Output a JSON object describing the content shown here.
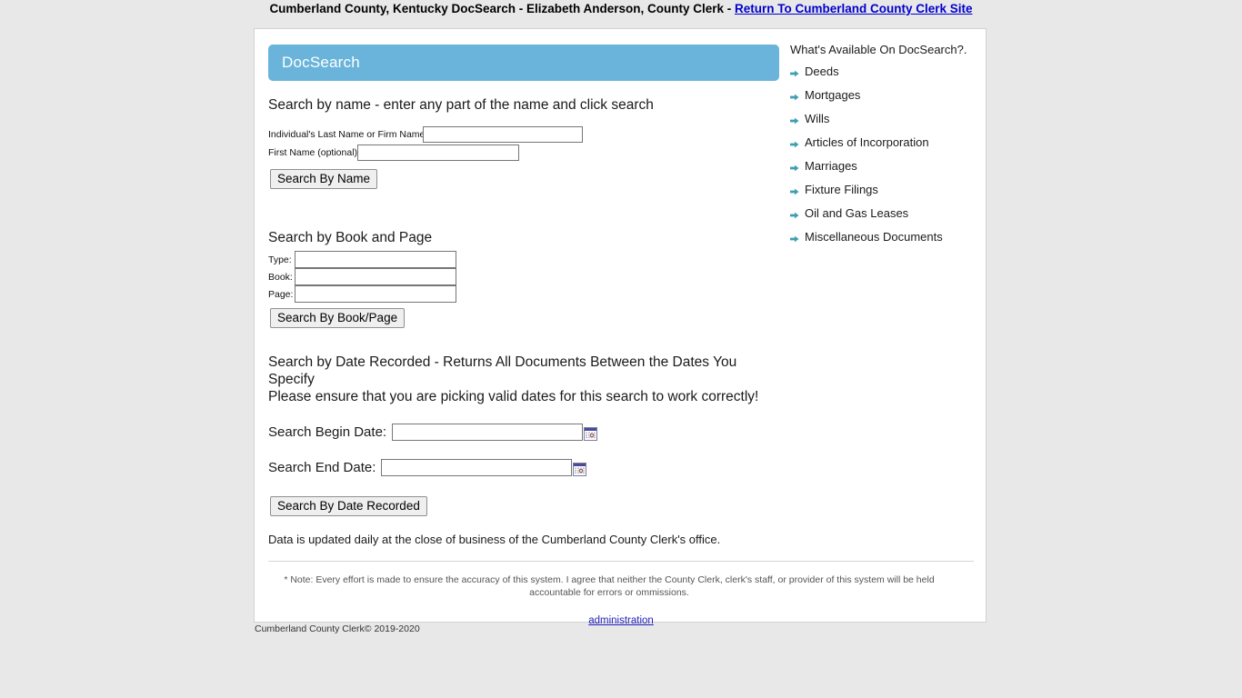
{
  "top_bar": {
    "title_plain": "Cumberland County, Kentucky DocSearch - Elizabeth Anderson, County Clerk - ",
    "link_label": "Return To Cumberland County Clerk Site"
  },
  "banner": {
    "label": "DocSearch",
    "color": "#6ab4db"
  },
  "name_search": {
    "heading": "Search by name - enter any part of the name and click search",
    "last_name_label": "Individual's Last Name or Firm Name",
    "last_name_value": "",
    "first_name_label": "First Name (optional)",
    "first_name_value": "",
    "button_label": "Search By Name"
  },
  "book_page_search": {
    "heading": "Search by Book and Page",
    "type_label": "Type:",
    "type_value": "",
    "book_label": "Book:",
    "book_value": "",
    "page_label": "Page:",
    "page_value": "",
    "button_label": "Search By Book/Page"
  },
  "date_search": {
    "heading": "Search by Date Recorded - Returns All Documents Between the Dates You Specify",
    "subheading": "Please ensure that you are picking valid dates for this search to work correctly!",
    "begin_label": "Search Begin Date:",
    "begin_value": "",
    "end_label": "Search End Date:",
    "end_value": "",
    "calendar_icon": "calendar-icon",
    "button_label": "Search By Date Recorded"
  },
  "data_note": "Data is updated daily at the close of business of the Cumberland County Clerk's office.",
  "disclaimer": "* Note: Every effort is made to ensure the accuracy of this system. I agree that neither the County Clerk, clerk's staff, or provider of this system will be held accountable for errors or ommissions.",
  "administration_link": "administration",
  "available": {
    "title": "What's Available On DocSearch?.",
    "bullet_icon": "arrow-right-icon",
    "bullet_color": "#3e9fb0",
    "items": [
      "Deeds",
      "Mortgages",
      "Wills",
      "Articles of Incorporation",
      "Marriages",
      "Fixture Filings",
      "Oil and Gas Leases",
      "Miscellaneous Documents"
    ]
  },
  "footer_copyright": "Cumberland County Clerk© 2019-2020"
}
